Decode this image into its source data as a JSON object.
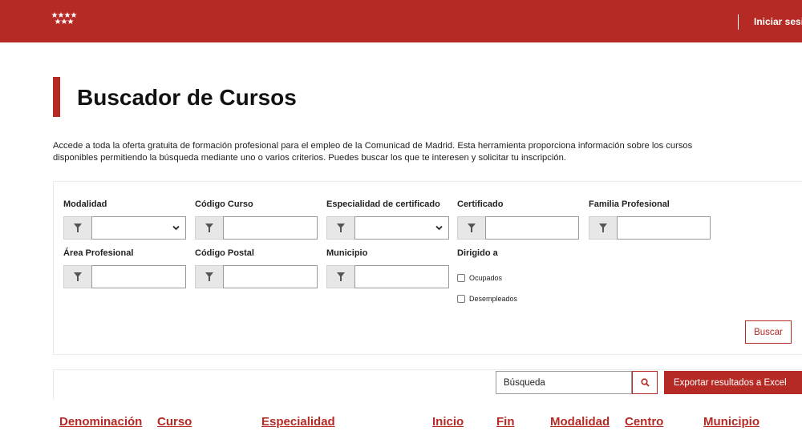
{
  "header": {
    "login_label": "Iniciar sesi"
  },
  "page": {
    "title": "Buscador de Cursos",
    "intro_line1": "Accede a toda la oferta gratuita de formación profesional para el empleo de la Comunicad de Madrid. Esta herramienta proporciona información sobre los cursos",
    "intro_line2": "disponibles permitiendo la búsqueda mediante uno o varios criterios. Puedes buscar los que te interesen y solicitar tu inscripción."
  },
  "filters": {
    "modalidad": {
      "label": "Modalidad",
      "value": ""
    },
    "codigo_curso": {
      "label": "Código Curso",
      "value": ""
    },
    "especialidad": {
      "label": "Especialidad de certificado",
      "value": ""
    },
    "certificado": {
      "label": "Certificado",
      "value": ""
    },
    "familia": {
      "label": "Familia Profesional",
      "value": ""
    },
    "area": {
      "label": "Área Profesional",
      "value": ""
    },
    "codigo_postal": {
      "label": "Código Postal",
      "value": ""
    },
    "municipio": {
      "label": "Municipio",
      "value": ""
    },
    "dirigido": {
      "label": "Dirigido a",
      "options": [
        {
          "label": "Ocupados",
          "checked": false
        },
        {
          "label": "Desempleados",
          "checked": false
        }
      ]
    },
    "buscar_label": "Buscar"
  },
  "results": {
    "search_value": "Búsqueda",
    "export_label": "Exportar resultados a Excel",
    "columns": [
      "Denominación",
      "Curso",
      "Especialidad",
      "Inicio",
      "Fin",
      "Modalidad",
      "Centro",
      "Municipio"
    ]
  },
  "icons": {
    "logo": "madrid-stars-icon",
    "filter": "filter-icon",
    "chevron": "chevron-down-icon",
    "search": "search-icon"
  },
  "colors": {
    "brand": "#b52a25"
  }
}
